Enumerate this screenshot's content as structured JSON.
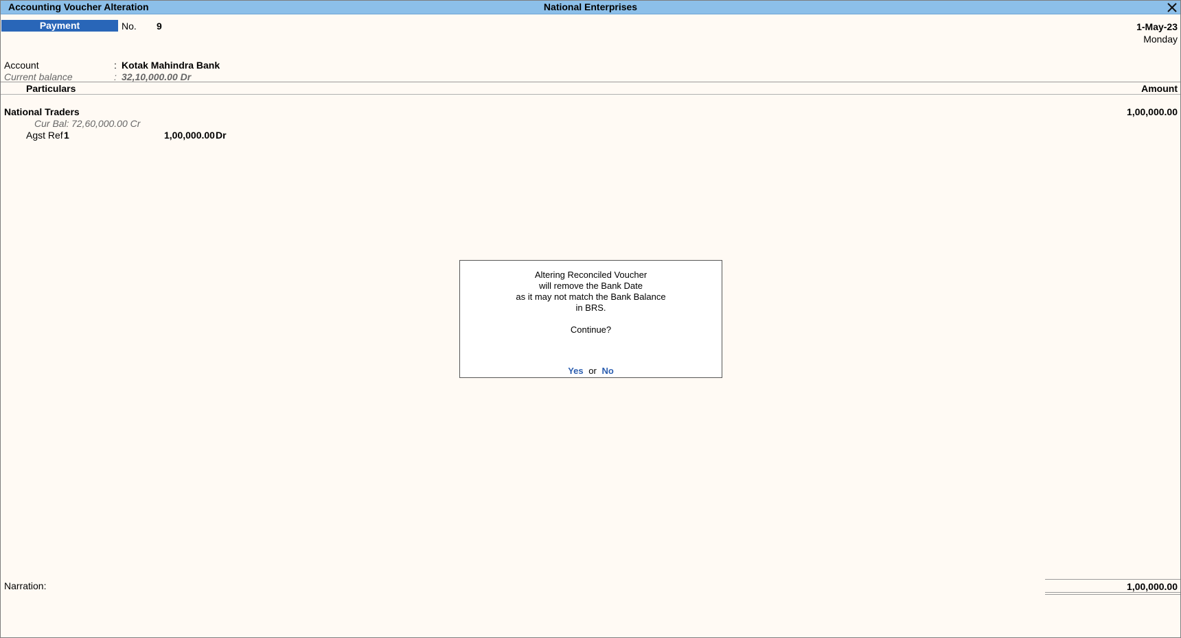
{
  "window": {
    "title": "Accounting Voucher Alteration",
    "company": "National Enterprises"
  },
  "voucher": {
    "type": "Payment",
    "number_label": "No.",
    "number": "9",
    "date": "1-May-23",
    "day": "Monday"
  },
  "account": {
    "label": "Account",
    "separator": ":",
    "value": "Kotak Mahindra Bank",
    "balance_label": "Current balance",
    "balance_value": "32,10,000.00 Dr"
  },
  "table": {
    "col_particulars": "Particulars",
    "col_amount": "Amount",
    "rows": [
      {
        "name": "National Traders",
        "cur_bal_label": "Cur Bal:",
        "cur_bal_value": "72,60,000.00 Cr",
        "ref_label": "Agst Ref",
        "ref_value": "1",
        "ref_amount": "1,00,000.00",
        "ref_side": "Dr",
        "amount": "1,00,000.00"
      }
    ]
  },
  "dialog": {
    "lines": [
      "Altering Reconciled Voucher",
      "will remove the Bank Date",
      "as it may not match the Bank Balance",
      "in BRS."
    ],
    "question": "Continue?",
    "yes": "Yes",
    "or": "or",
    "no": "No"
  },
  "footer": {
    "narration_label": "Narration:",
    "total": "1,00,000.00"
  },
  "colors": {
    "titlebar": "#8cbfe9",
    "voucher_type_bg": "#2966b8",
    "background": "#fffaf4",
    "link": "#2d5fb0"
  }
}
